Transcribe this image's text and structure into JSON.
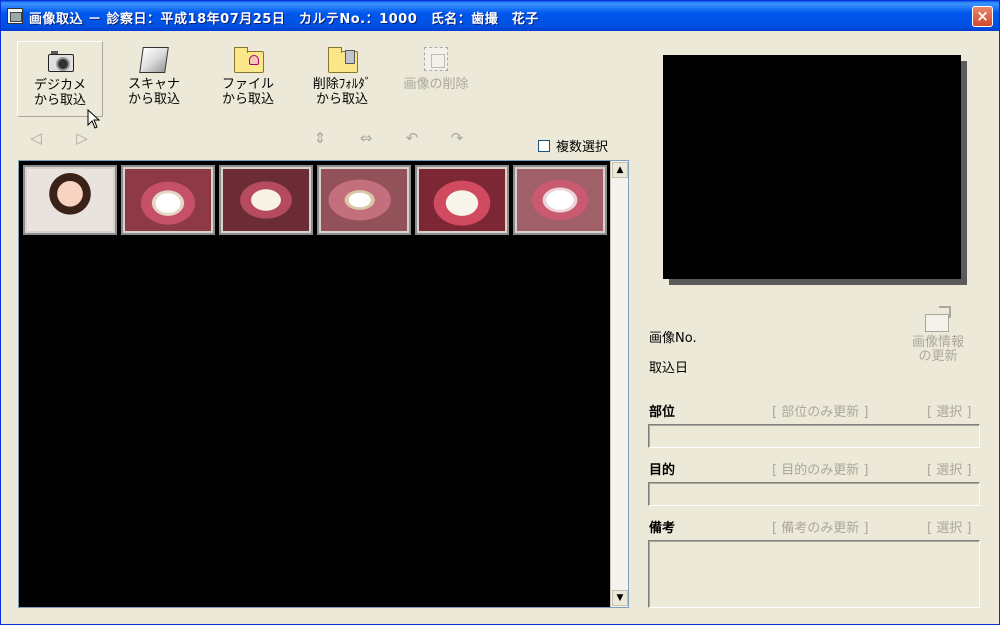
{
  "window": {
    "title": "画像取込 － 診察日：平成18年07月25日　カルテNo.：1000　氏名：歯撮　花子",
    "close_label": "×"
  },
  "toolbar": [
    {
      "id": "camera",
      "label": "デジカメ\nから取込",
      "icon": "camera-icon",
      "enabled": true
    },
    {
      "id": "scanner",
      "label": "スキャナ\nから取込",
      "icon": "scanner-icon",
      "enabled": true
    },
    {
      "id": "file",
      "label": "ファイル\nから取込",
      "icon": "folder-icon",
      "enabled": true
    },
    {
      "id": "deleted-folder",
      "label": "削除ﾌｫﾙﾀﾞ\nから取込",
      "icon": "deleted-folder-icon",
      "enabled": true
    },
    {
      "id": "delete-image",
      "label": "画像の削除",
      "icon": "delete-image-icon",
      "enabled": false
    }
  ],
  "nav": {
    "prev": "◁",
    "next": "▷",
    "flip_vertical": "⇕",
    "flip_horizontal": "⇔",
    "rotate_left": "↶",
    "rotate_right": "↷"
  },
  "multi_select": {
    "label": "複数選択",
    "checked": false
  },
  "thumbnails": [
    {
      "name": "thumbnail-face"
    },
    {
      "name": "thumbnail-front-teeth"
    },
    {
      "name": "thumbnail-lower-arch"
    },
    {
      "name": "thumbnail-side-teeth"
    },
    {
      "name": "thumbnail-smile"
    },
    {
      "name": "thumbnail-front-bite"
    }
  ],
  "scroll": {
    "up": "▲",
    "down": "▼"
  },
  "info": {
    "image_no_label": "画像No.",
    "import_date_label": "取込日",
    "update_button": "画像情報\nの更新"
  },
  "fields": {
    "site": {
      "label": "部位",
      "update_link": "[ 部位のみ更新 ]",
      "select_link": "[ 選択 ]",
      "value": ""
    },
    "purpose": {
      "label": "目的",
      "update_link": "[ 目的のみ更新 ]",
      "select_link": "[ 選択 ]",
      "value": ""
    },
    "notes": {
      "label": "備考",
      "update_link": "[ 備考のみ更新 ]",
      "select_link": "[ 選択 ]",
      "value": ""
    }
  }
}
